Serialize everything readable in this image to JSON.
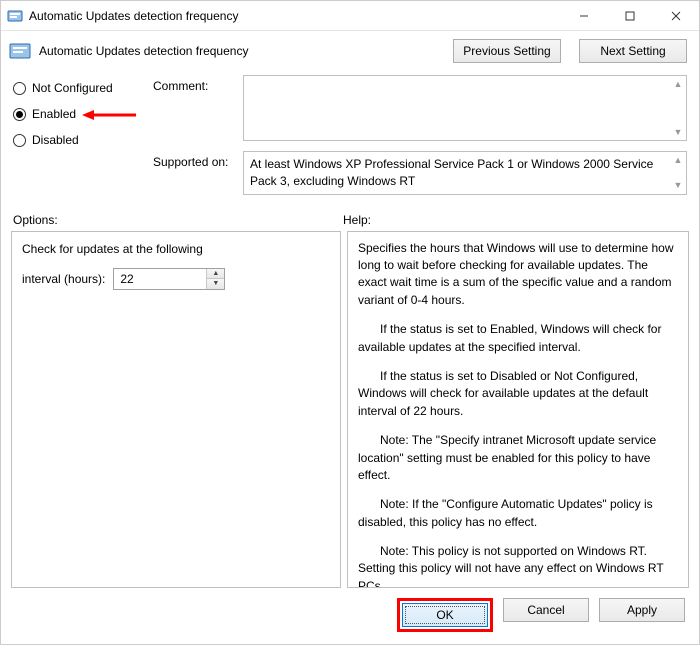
{
  "window": {
    "title": "Automatic Updates detection frequency"
  },
  "header": {
    "title": "Automatic Updates detection frequency",
    "prev": "Previous Setting",
    "next": "Next Setting"
  },
  "radio": {
    "not_configured": "Not Configured",
    "enabled": "Enabled",
    "disabled": "Disabled",
    "selected": "enabled"
  },
  "form": {
    "comment_label": "Comment:",
    "comment_value": "",
    "supported_label": "Supported on:",
    "supported_value": "At least Windows XP Professional Service Pack 1 or Windows 2000 Service Pack 3, excluding Windows RT"
  },
  "sections": {
    "options": "Options:",
    "help": "Help:"
  },
  "options": {
    "line1": "Check for updates at the following",
    "line2_label": "interval (hours):",
    "interval_value": "22"
  },
  "help": {
    "p1": "Specifies the hours that Windows will use to determine how long to wait before checking for available updates. The exact wait time is a sum of the specific value and a random variant of 0-4 hours.",
    "p2": "If the status is set to Enabled, Windows will check for available updates at the specified interval.",
    "p3": "If the status is set to Disabled or Not Configured, Windows will check for available updates at the default interval of 22 hours.",
    "p4": "Note: The \"Specify intranet Microsoft update service location\" setting must be enabled for this policy to have effect.",
    "p5": "Note: If the \"Configure Automatic Updates\" policy is disabled, this policy has no effect.",
    "p6": "Note: This policy is not supported on Windows RT. Setting this policy will not have any effect on Windows RT PCs."
  },
  "footer": {
    "ok": "OK",
    "cancel": "Cancel",
    "apply": "Apply"
  }
}
